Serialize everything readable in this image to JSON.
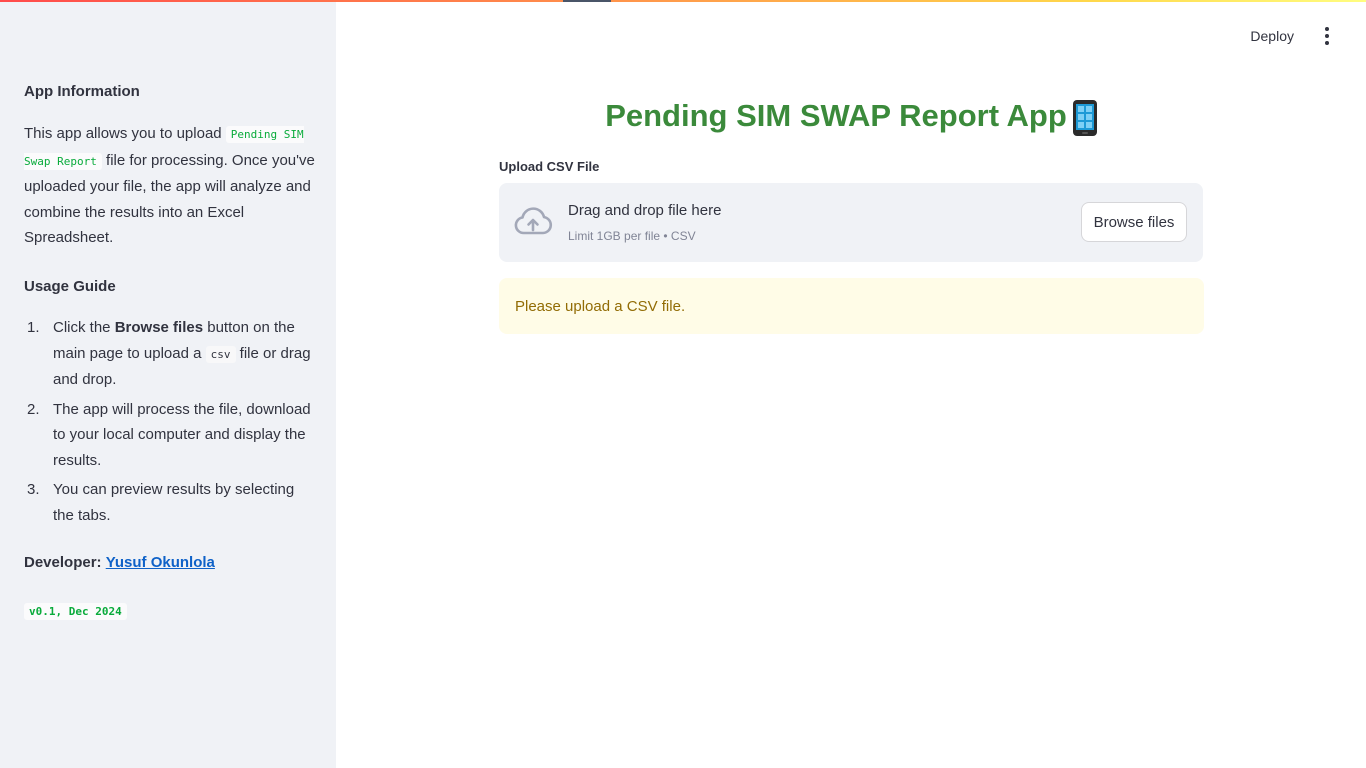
{
  "sidebar": {
    "app_info_heading": "App Information",
    "app_info": {
      "before": "This app allows you to upload",
      "code": "Pending SIM Swap Report",
      "after": "file for processing. Once you've uploaded your file, the app will analyze and combine the results into an Excel Spreadsheet."
    },
    "usage_heading": "Usage Guide",
    "usage_items": [
      {
        "num": "1.",
        "text_a": "Click the",
        "bold": "Browse files",
        "text_b": "button on the main page to upload a",
        "code": "csv",
        "text_c": "file or drag and drop."
      },
      {
        "num": "2.",
        "text": "The app will process the file, download to your local computer and display the results."
      },
      {
        "num": "3.",
        "text": "You can preview results by selecting the tabs."
      }
    ],
    "developer_label": "Developer:",
    "developer_name": "Yusuf Okunlola",
    "version": "v0.1, Dec 2024"
  },
  "header": {
    "deploy_label": "Deploy",
    "menu_icon": "vertical-ellipsis-icon"
  },
  "main": {
    "title": "Pending SIM SWAP Report App",
    "title_icon": "mobile-phone-icon",
    "uploader": {
      "label": "Upload CSV File",
      "drop_text": "Drag and drop file here",
      "limit_text": "Limit 1GB per file • CSV",
      "browse_label": "Browse files",
      "icon": "cloud-upload-icon"
    },
    "warning_text": "Please upload a CSV file."
  },
  "colors": {
    "title_green": "#3b8a3b",
    "code_green": "#09ab3b",
    "link_blue": "#0f62c8",
    "warning_bg": "#fffce7",
    "warning_text": "#926c05",
    "sidebar_bg": "#f0f2f6"
  }
}
